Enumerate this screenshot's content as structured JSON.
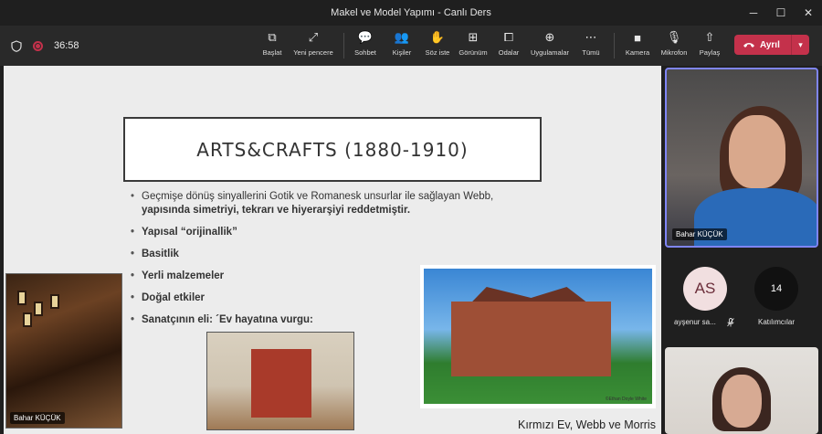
{
  "window": {
    "title": "Makel ve Model Yapımı - Canlı Ders",
    "controls": [
      "─",
      "☐",
      "✕"
    ]
  },
  "toolbar": {
    "timer": "36:58",
    "buttons": [
      {
        "label": "Başlat",
        "icon": "share-screen-icon",
        "glyph": "⧉"
      },
      {
        "label": "Yeni pencere",
        "icon": "new-window-icon",
        "glyph": "⤢"
      },
      {
        "label": "Sohbet",
        "icon": "chat-icon",
        "glyph": "💬"
      },
      {
        "label": "Kişiler",
        "icon": "people-icon",
        "glyph": "👥"
      },
      {
        "label": "Söz iste",
        "icon": "raise-hand-icon",
        "glyph": "✋"
      },
      {
        "label": "Görünüm",
        "icon": "view-icon",
        "glyph": "⊞"
      },
      {
        "label": "Odalar",
        "icon": "rooms-icon",
        "glyph": "⧠"
      },
      {
        "label": "Uygulamalar",
        "icon": "apps-icon",
        "glyph": "⊕"
      },
      {
        "label": "Tümü",
        "icon": "more-icon",
        "glyph": "⋯"
      },
      {
        "label": "Kamera",
        "icon": "camera-icon",
        "glyph": "■"
      },
      {
        "label": "Mikrofon",
        "icon": "mic-off-icon",
        "glyph": "🎙"
      },
      {
        "label": "Paylaş",
        "icon": "share-icon",
        "glyph": "⇧"
      }
    ],
    "leave_label": "Ayrıl"
  },
  "slide": {
    "title": "ARTS&CRAFTS (1880-1910)",
    "bullet1_line1": "Geçmişe dönüş sinyallerini Gotik ve Romanesk unsurlar ile sağlayan Webb,",
    "bullet1_line2": "yapısında simetriyi, tekrarı ve hiyerarşiyi reddetmiştir.",
    "bullets": [
      "Yapısal “orijinallik”",
      "Basitlik",
      "Yerli malzemeler",
      "Doğal etkiler",
      "Sanatçının eli: ´Ev hayatına vurgu:"
    ],
    "photo_credit": "©Ethan Doyle White",
    "caption": "Kırmızı Ev, Webb ve Morris",
    "presenter_tag": "Bahar KÜÇÜK"
  },
  "participants": {
    "main_name": "Bahar KÜÇÜK",
    "avatar_initials": "AS",
    "avatar_name": "ayşenur sa...",
    "count": "14",
    "count_label": "Katılımcılar"
  }
}
